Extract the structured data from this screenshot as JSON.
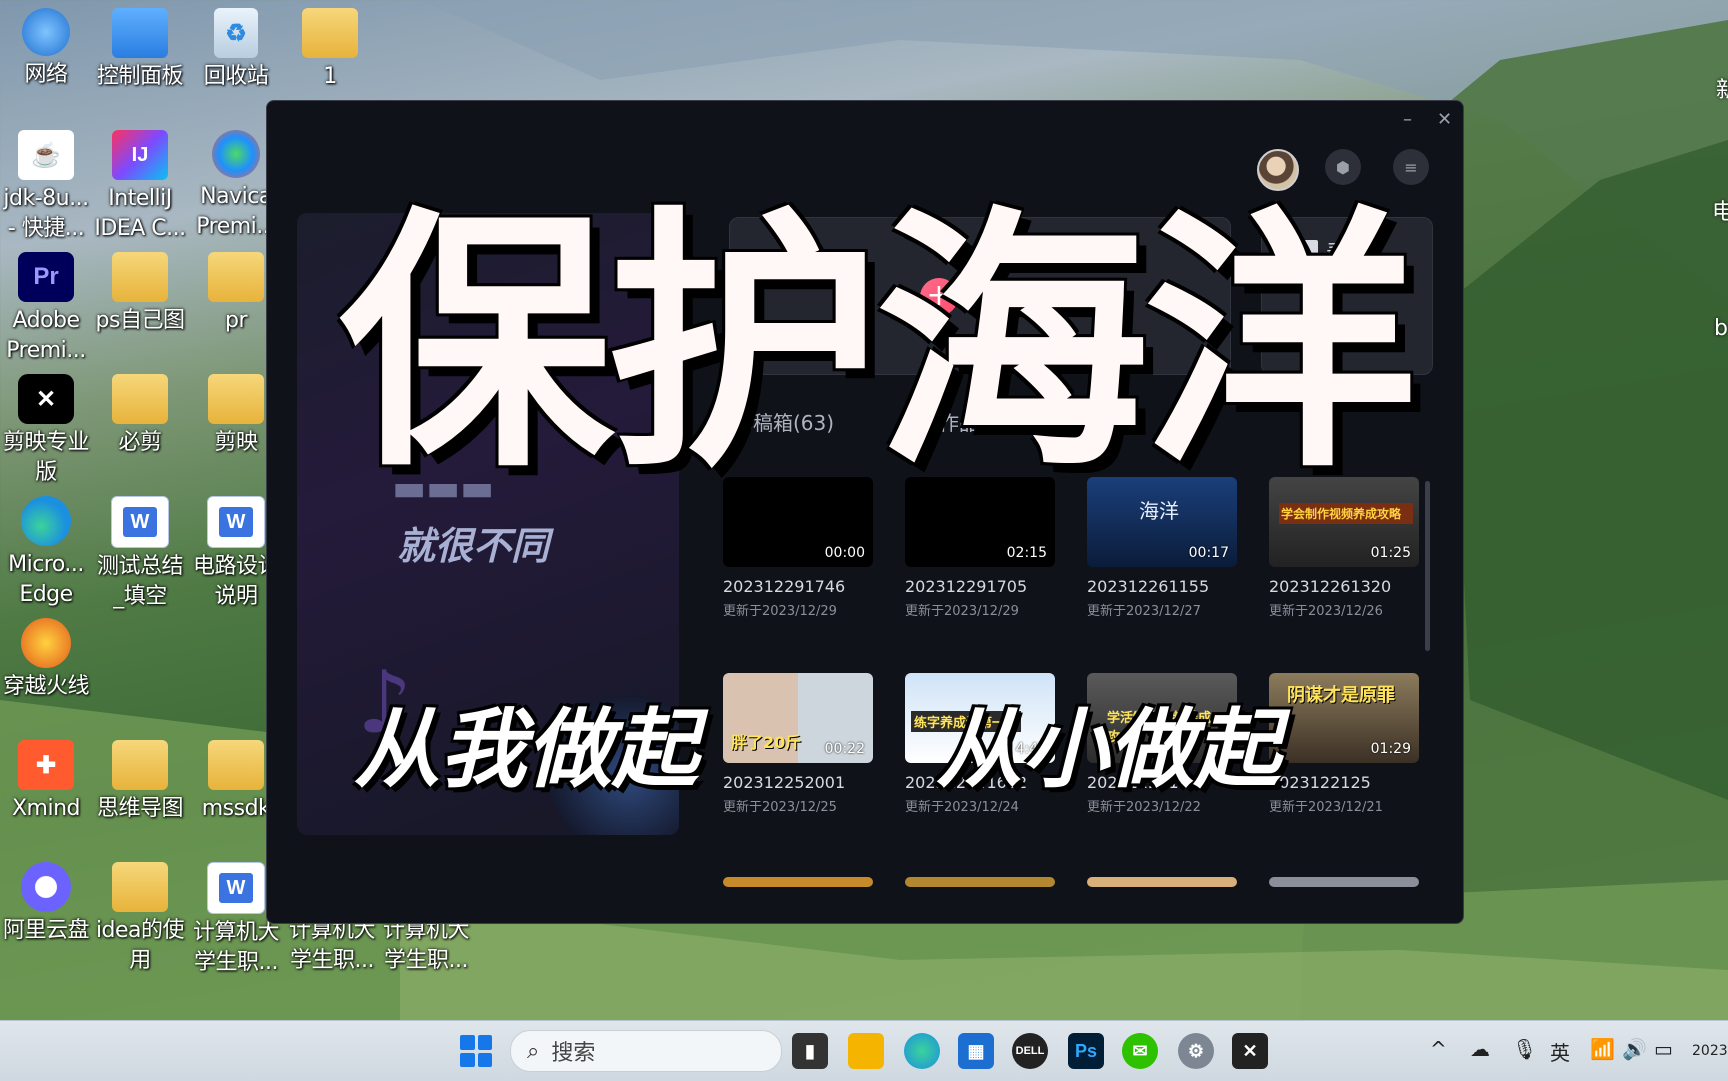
{
  "desktop": {
    "icons": [
      {
        "label": "网络",
        "icon": "network-icon"
      },
      {
        "label": "控制面板",
        "icon": "control-panel-icon"
      },
      {
        "label": "回收站",
        "icon": "recycle-bin-icon"
      },
      {
        "label": "1",
        "icon": "user-folder-icon"
      },
      {
        "label": "jdk-8u...\n- 快捷...",
        "icon": "java-icon"
      },
      {
        "label": "IntelliJ\nIDEA C...",
        "icon": "intellij-icon"
      },
      {
        "label": "Navica\nPremi...",
        "icon": "navicat-icon"
      },
      {
        "label": "Adobe\nPremi...",
        "icon": "premiere-icon"
      },
      {
        "label": "ps自己图",
        "icon": "folder-icon"
      },
      {
        "label": "pr",
        "icon": "folder-icon"
      },
      {
        "label": "剪映专业\n版",
        "icon": "capcut-icon"
      },
      {
        "label": "必剪",
        "icon": "folder-icon"
      },
      {
        "label": "剪映",
        "icon": "folder-icon"
      },
      {
        "label": "Micro...\nEdge",
        "icon": "edge-icon"
      },
      {
        "label": "测试总结\n_填空",
        "icon": "word-doc-icon"
      },
      {
        "label": "电路设计\n说明",
        "icon": "word-doc-icon"
      },
      {
        "label": "穿越火线",
        "icon": "crossfire-icon"
      },
      {
        "label": "Xmind",
        "icon": "xmind-icon"
      },
      {
        "label": "思维导图",
        "icon": "folder-icon"
      },
      {
        "label": "mssdk",
        "icon": "folder-icon"
      },
      {
        "label": "阿里云盘",
        "icon": "aliyun-drive-icon"
      },
      {
        "label": "idea的使\n用",
        "icon": "folder-icon"
      },
      {
        "label": "计算机大\n学生职...",
        "icon": "word-doc-icon"
      },
      {
        "label": "计算机大\n学生职...",
        "icon": "none"
      },
      {
        "label": "计算机大\n学生职...",
        "icon": "none"
      }
    ],
    "right_edge_text": [
      "新",
      "电",
      "b"
    ]
  },
  "window": {
    "recorder_label": "录屏",
    "left_panel_slogan": "就很不同",
    "tabs": [
      "草稿箱(63)",
      "本地作品"
    ],
    "drafts": [
      {
        "name": "202312291746",
        "updated": "更新于2023/12/29",
        "duration": "00:00",
        "thumb": "black"
      },
      {
        "name": "202312291705",
        "updated": "更新于2023/12/29",
        "duration": "02:15",
        "thumb": "black"
      },
      {
        "name": "202312261155",
        "updated": "更新于2023/12/27",
        "duration": "00:17",
        "thumb": "ocean",
        "thumb_text": "海洋"
      },
      {
        "name": "202312261320",
        "updated": "更新于2023/12/26",
        "duration": "01:25",
        "thumb": "study",
        "thumb_text": "学会制作视频养成攻略"
      },
      {
        "name": "202312252001",
        "updated": "更新于2023/12/25",
        "duration": "00:22",
        "thumb": "faces",
        "thumb_text": "胖了20斤"
      },
      {
        "name": "202312241632",
        "updated": "更新于2023/12/24",
        "duration": "4:47",
        "thumb": "screen",
        "thumb_text": "练字养成记第一天"
      },
      {
        "name": "202312221",
        "updated": "更新于2023/12/22",
        "duration": "",
        "thumb": "gray",
        "thumb_text": "学活制作视频养成攻"
      },
      {
        "name": "2023122125",
        "updated": "更新于2023/12/21",
        "duration": "01:29",
        "thumb": "poster",
        "thumb_text": "阴谋才是原罪"
      }
    ]
  },
  "overlay": {
    "title": "保护海洋",
    "sub_left": "从我做起",
    "sub_right": "从小做起"
  },
  "taskbar": {
    "search_placeholder": "搜索",
    "ime": "英",
    "clock_partial": "2023"
  },
  "colors": {
    "window_bg": "#10121a",
    "accent_plus": "#ff4d6d",
    "taskbar_bg": "#dfe6ec"
  }
}
